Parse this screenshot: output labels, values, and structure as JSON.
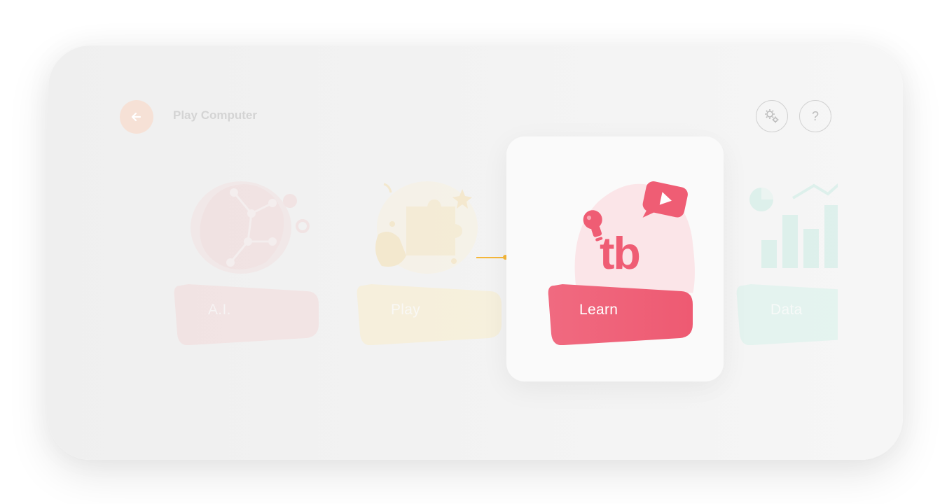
{
  "header": {
    "title": "Play Computer",
    "back_icon": "arrow-left-icon",
    "settings_icon": "gears-icon",
    "help_label": "?"
  },
  "cards": [
    {
      "id": "ai",
      "label": "A.I.",
      "icon": "brain-network-icon",
      "color": "#f2c9c9",
      "state": "faded"
    },
    {
      "id": "play",
      "label": "Play",
      "icon": "puzzle-icon",
      "color": "#f8e6b8",
      "state": "faded"
    },
    {
      "id": "learn",
      "label": "Learn",
      "icon": "tb-learn-icon",
      "color": "#ef5d74",
      "state": "selected"
    },
    {
      "id": "data",
      "label": "Data",
      "icon": "bar-chart-icon",
      "color": "#bdeee2",
      "state": "faded"
    }
  ],
  "colors": {
    "accent": "#ef5d74",
    "connector": "#f5b73a",
    "back_button": "#f6e1d6"
  }
}
